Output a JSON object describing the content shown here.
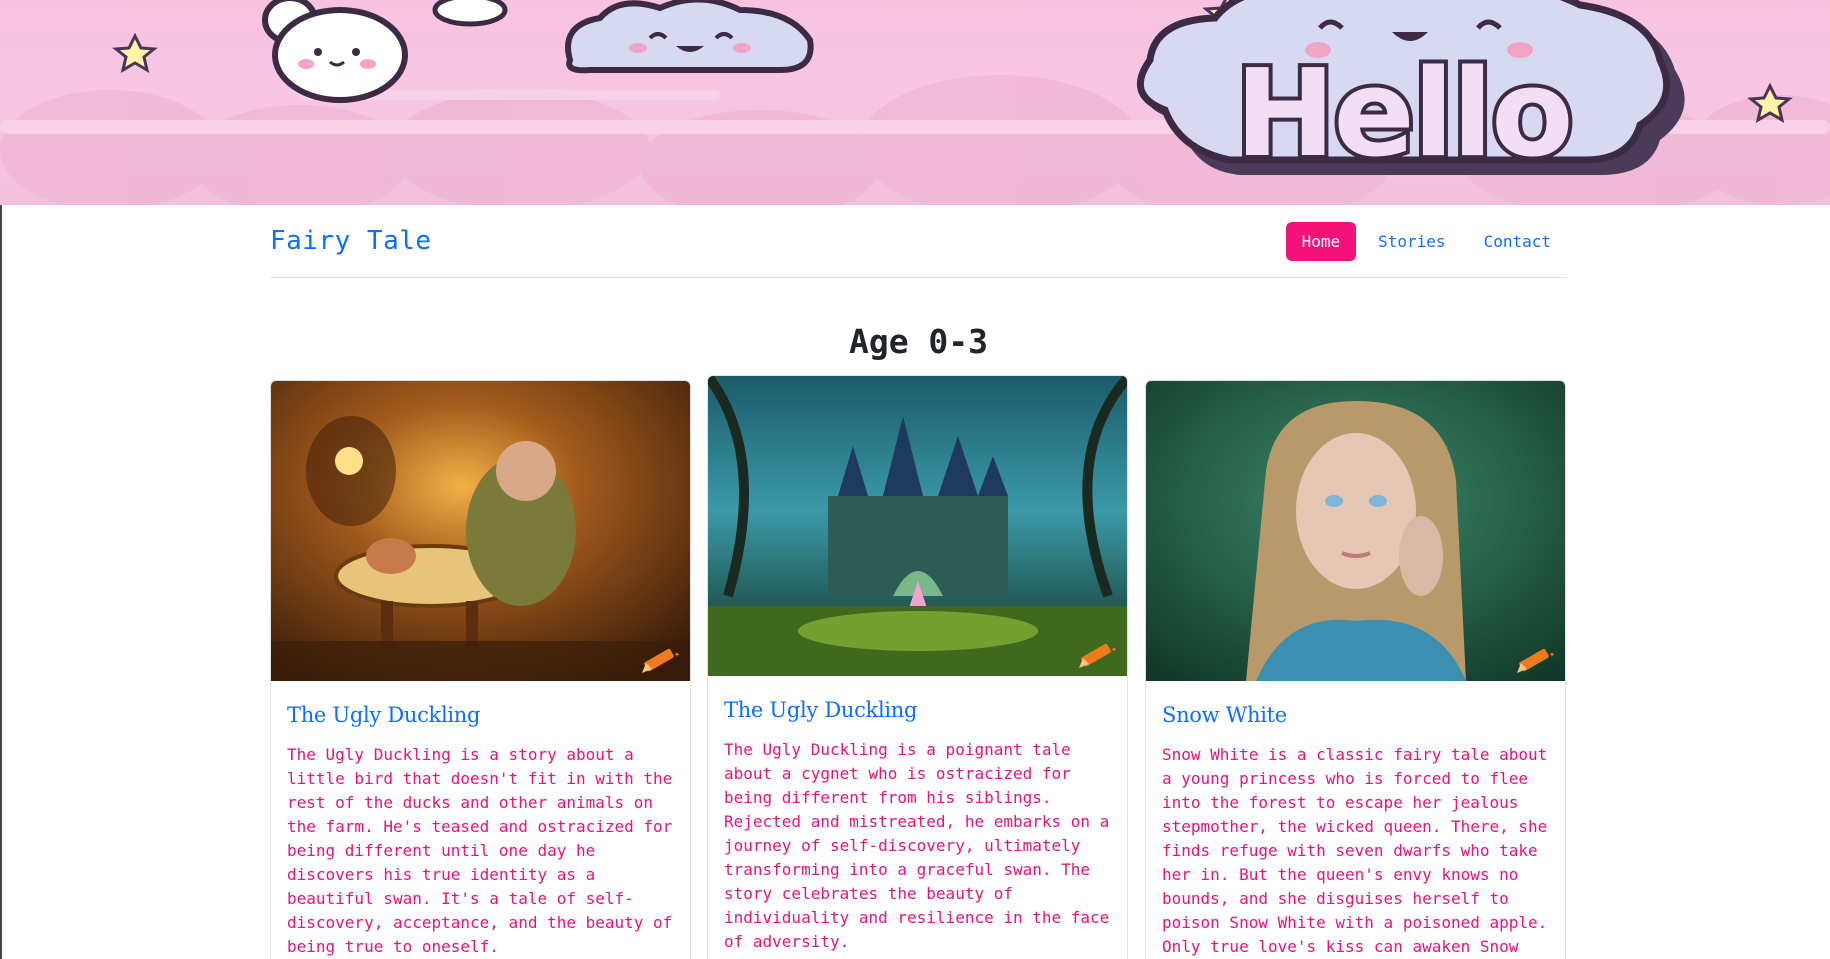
{
  "banner": {
    "hello_text": "Hello",
    "alt": "Kawaii clouds banner"
  },
  "navbar": {
    "brand": "Fairy Tale",
    "links": [
      {
        "label": "Home",
        "active": true
      },
      {
        "label": "Stories",
        "active": false
      },
      {
        "label": "Contact",
        "active": false
      }
    ]
  },
  "section": {
    "title": "Age 0-3"
  },
  "cards": [
    {
      "title": "The Ugly Duckling",
      "text": "The Ugly Duckling is a story about a little bird that doesn't fit in with the rest of the ducks and other animals on the farm. He's teased and ostracized for being different until one day he discovers his true identity as a beautiful swan. It's a tale of self-discovery, acceptance, and the beauty of being true to oneself."
    },
    {
      "title": "The Ugly Duckling",
      "text": "The Ugly Duckling is a poignant tale about a cygnet who is ostracized for being different from his siblings. Rejected and mistreated, he embarks on a journey of self-discovery, ultimately transforming into a graceful swan. The story celebrates the beauty of individuality and resilience in the face of adversity."
    },
    {
      "title": "Snow White",
      "text": "Snow White is a classic fairy tale about a young princess who is forced to flee into the forest to escape her jealous stepmother, the wicked queen. There, she finds refuge with seven dwarfs who take her in. But the queen's envy knows no bounds, and she disguises herself to poison Snow White with a poisoned apple. Only true love's kiss can awaken Snow"
    }
  ],
  "colors": {
    "accent": "#f5117a",
    "link": "#0d6efd",
    "body_text": "#e8127e"
  },
  "icons": [
    "star-icon",
    "bunny-icon",
    "cloud-face-icon",
    "pencil-icon"
  ]
}
